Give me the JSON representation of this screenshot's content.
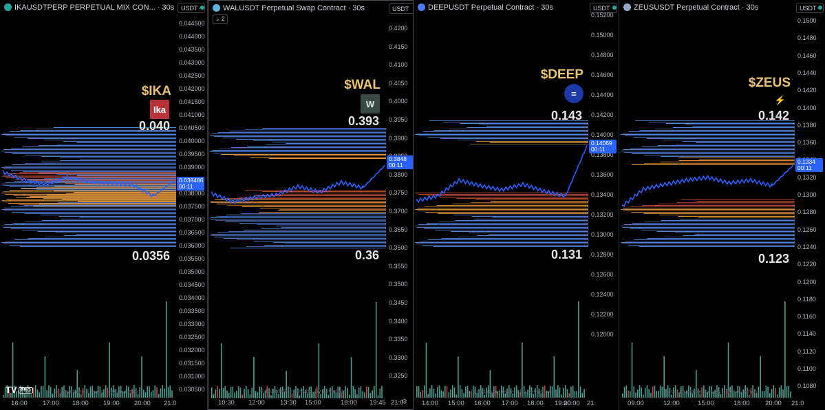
{
  "panels": [
    {
      "title": "IKAUSDTPERP PERPETUAL MIX CON... · 30s",
      "currency": "USDT",
      "ticker": "$IKA",
      "logo_text": "Ika",
      "upper_level": "0.040",
      "lower_level": "0.0356",
      "price": "0.038486",
      "countdown": "00:11",
      "y_ticks": [
        "0.044500",
        "0.044000",
        "0.043500",
        "0.043000",
        "0.042500",
        "0.042000",
        "0.041500",
        "0.041000",
        "0.040500",
        "0.040000",
        "0.039500",
        "0.039000",
        "0.038500",
        "0.038000",
        "0.037500",
        "0.037000",
        "0.036500",
        "0.036000",
        "0.035500",
        "0.035000",
        "0.034500",
        "0.034000",
        "0.033500",
        "0.033000",
        "0.032500",
        "0.032000",
        "0.031500",
        "0.031000",
        "0.030500"
      ],
      "x_ticks": [
        "16:00",
        "17:00",
        "18:00",
        "19:00",
        "20:00",
        "21:0"
      ],
      "watermark": "© Liquidation Levels - By Leviathan",
      "tv_logo": "TV",
      "tv_pro": "PRO",
      "icon": "ika-icon",
      "accent": "#26a69a"
    },
    {
      "title": "WALUSDT Perpetual Swap Contract · 30s",
      "currency": "USDT",
      "ticker": "$WAL",
      "logo_text": "W",
      "upper_level": "0.393",
      "lower_level": "0.36",
      "price": "0.3848",
      "countdown": "00:11",
      "collapse_count": "2",
      "y_ticks": [
        "0.4200",
        "0.4150",
        "0.4100",
        "0.4050",
        "0.4000",
        "0.3950",
        "0.3900",
        "0.3850",
        "0.3800",
        "0.3750",
        "0.3700",
        "0.3650",
        "0.3600",
        "0.3550",
        "0.3500",
        "0.3450",
        "0.3400",
        "0.3350",
        "0.3300",
        "0.3250"
      ],
      "x_ticks": [
        "10:30",
        "12:00",
        "13:30",
        "15:00",
        "18:00",
        "19:45",
        "21:0"
      ],
      "watermark": "© Liquidation Levels - By Leviathan",
      "icon": "wal-icon"
    },
    {
      "title": "DEEPUSDT Perpetual Contract · 30s",
      "currency": "USDT",
      "ticker": "$DEEP",
      "logo_text": "=",
      "upper_level": "0.143",
      "lower_level": "0.131",
      "price": "0.14069",
      "countdown": "00:11",
      "y_ticks": [
        "0.15200",
        "0.15000",
        "0.14800",
        "0.14600",
        "0.14400",
        "0.14200",
        "0.14000",
        "0.13800",
        "0.13600",
        "0.13400",
        "0.13200",
        "0.13000",
        "0.12800",
        "0.12600",
        "0.12400",
        "0.12200",
        "0.12000"
      ],
      "x_ticks": [
        "14:00",
        "15:00",
        "16:00",
        "17:00",
        "18:00",
        "19:00",
        "20:00",
        "21:"
      ],
      "watermark": "© Liquidation Levels - By Leviathan",
      "icon": "deep-icon"
    },
    {
      "title": "ZEUSUSDT Perpetual Contract · 30s",
      "currency": "USDT",
      "ticker": "$ZEUS",
      "logo_text": "⚡",
      "upper_level": "0.142",
      "lower_level": "0.123",
      "price": "0.1334",
      "countdown": "00:11",
      "y_ticks": [
        "0.1500",
        "0.1480",
        "0.1460",
        "0.1440",
        "0.1420",
        "0.1400",
        "0.1380",
        "0.1360",
        "0.1340",
        "0.1320",
        "0.1300",
        "0.1280",
        "0.1260",
        "0.1240",
        "0.1220",
        "0.1200",
        "0.1180",
        "0.1160",
        "0.1140",
        "0.1120",
        "0.1100",
        "0.1080"
      ],
      "x_ticks": [
        "09:00",
        "12:00",
        "15:00",
        "18:00",
        "20:00",
        "21:0"
      ],
      "watermark": "© Liquidation Levels - By Leviathan",
      "icon": "zeus-icon"
    }
  ],
  "colors": {
    "line": "#2962ff",
    "heat_blue": "#5b8ee6",
    "heat_orange": "#f0a040",
    "heat_red": "#e0553a",
    "vol_green": "#5fb8a8",
    "vol_red": "#d9534f",
    "ticker_gold": "#e8c372"
  },
  "chart_data": [
    {
      "type": "line",
      "title": "IKAUSDTPERP PERPETUAL MIX CON... · 30s",
      "xlabel": "",
      "ylabel": "",
      "x": [
        "16:00",
        "17:00",
        "18:00",
        "19:00",
        "20:00",
        "21:0"
      ],
      "series": [
        {
          "values": [
            0.0387,
            0.0382,
            0.0384,
            0.0381,
            0.0383,
            0.0378,
            0.0382,
            0.03849
          ]
        }
      ],
      "ylim": [
        0.0303,
        0.0447
      ],
      "annotations": {
        "upper": 0.04,
        "lower": 0.0356,
        "last": 0.038486
      }
    },
    {
      "type": "line",
      "title": "WALUSDT Perpetual Swap Contract · 30s",
      "xlabel": "",
      "ylabel": "",
      "x": [
        "10:30",
        "12:00",
        "13:30",
        "15:00",
        "18:00",
        "19:45",
        "21:0"
      ],
      "series": [
        {
          "values": [
            0.378,
            0.3755,
            0.376,
            0.3775,
            0.379,
            0.377,
            0.38,
            0.3848
          ]
        }
      ],
      "ylim": [
        0.32,
        0.423
      ],
      "annotations": {
        "upper": 0.393,
        "lower": 0.36,
        "last": 0.3848
      }
    },
    {
      "type": "line",
      "title": "DEEPUSDT Perpetual Contract · 30s",
      "xlabel": "",
      "ylabel": "",
      "x": [
        "14:00",
        "15:00",
        "16:00",
        "17:00",
        "18:00",
        "19:00",
        "20:00",
        "21:"
      ],
      "series": [
        {
          "values": [
            0.1358,
            0.1362,
            0.1378,
            0.1368,
            0.1372,
            0.1366,
            0.1373,
            0.1362,
            0.14069
          ]
        }
      ],
      "ylim": [
        0.119,
        0.1525
      ],
      "annotations": {
        "upper": 0.143,
        "lower": 0.131,
        "last": 0.14069
      }
    },
    {
      "type": "line",
      "title": "ZEUSUSDT Perpetual Contract · 30s",
      "xlabel": "",
      "ylabel": "",
      "x": [
        "09:00",
        "12:00",
        "15:00",
        "18:00",
        "20:00",
        "21:0"
      ],
      "series": [
        {
          "values": [
            0.129,
            0.131,
            0.1312,
            0.1318,
            0.1325,
            0.132,
            0.1325,
            0.1318,
            0.1334
          ]
        }
      ],
      "ylim": [
        0.107,
        0.151
      ],
      "annotations": {
        "upper": 0.142,
        "lower": 0.123,
        "last": 0.1334
      }
    }
  ]
}
